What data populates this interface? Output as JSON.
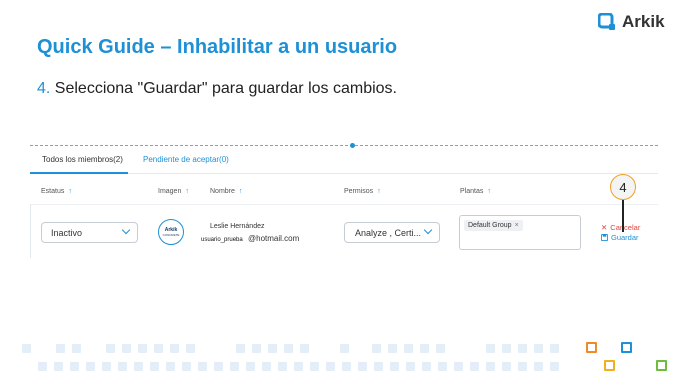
{
  "brand": {
    "name": "Arkik"
  },
  "slide": {
    "title": "Quick Guide – Inhabilitar a un usuario",
    "step_number": "4.",
    "step_text": " Selecciona \"Guardar\" para guardar los cambios."
  },
  "tabs": [
    {
      "label": "Todos los miembros(2)",
      "active": true
    },
    {
      "label": "Pendiente de aceptar(0)",
      "active": false
    }
  ],
  "columns": {
    "status": "Estatus",
    "image": "Imagen",
    "name": "Nombre",
    "permissions": "Permisos",
    "plants": "Plantas"
  },
  "row": {
    "status_value": "Inactivo",
    "avatar_text": "Arkik",
    "avatar_sub": "CONCRETE",
    "name": "Leslie Hernández",
    "user_id": "usuario_prueba",
    "email_suffix": "@hotmail.com",
    "permissions_value": "Analyze ,  Certi...",
    "plant_chip": "Default Group",
    "plant_chip_remove": "×",
    "cancel_label": "Cancelar",
    "save_label": "Guardar"
  },
  "callout": {
    "number": "4"
  },
  "colors": {
    "accent": "#1e90d6",
    "cancel": "#e0453d",
    "callout_border": "#f0a020"
  },
  "icons": {
    "sort": "sort-arrow-icon",
    "cancel": "close-icon",
    "save": "save-icon",
    "dropdown": "chevron-down-icon"
  }
}
